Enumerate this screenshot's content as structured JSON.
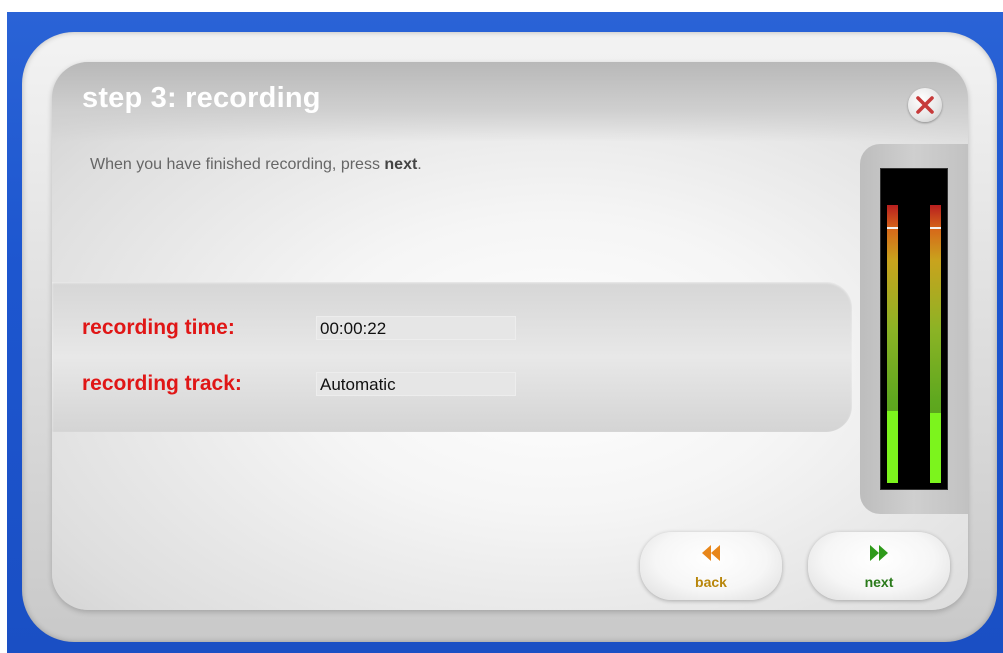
{
  "dialog": {
    "title": "step 3: recording",
    "instruction_prefix": "When you have finished recording, press ",
    "instruction_emphasis": "next",
    "instruction_suffix": "."
  },
  "fields": [
    {
      "label": "recording time:",
      "value": "00:00:22"
    },
    {
      "label": "recording track:",
      "value": "Automatic"
    }
  ],
  "level_meter": {
    "channels": [
      {
        "name": "left",
        "level": 0.26,
        "peak": 0.92
      },
      {
        "name": "right",
        "level": 0.25,
        "peak": 0.92
      }
    ],
    "colors": {
      "top": "#b81f1f",
      "middle": "#c9a31d",
      "bottom": "#4d9a1a",
      "active": "#7cf41d"
    }
  },
  "buttons": {
    "back": {
      "label": "back",
      "icon": "rewind-icon",
      "color": "#e8861a"
    },
    "next": {
      "label": "next",
      "icon": "fast-forward-icon",
      "color": "#2e9a1a"
    },
    "close": {
      "icon": "close-icon",
      "color": "#c73a3a"
    }
  },
  "colors": {
    "frame_blue": "#2a63d6",
    "label_red": "#e01616",
    "title_white": "#ffffff"
  }
}
